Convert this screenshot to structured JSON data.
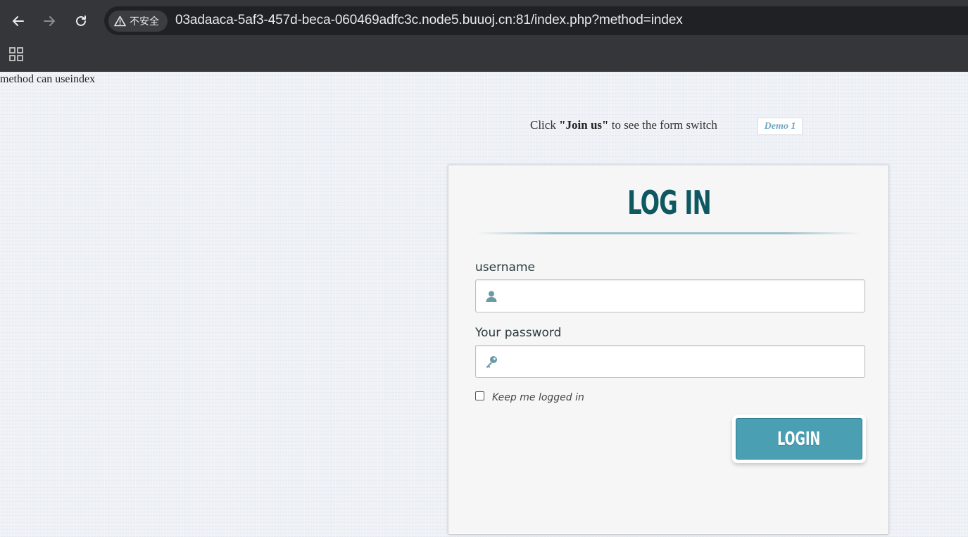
{
  "browser": {
    "security_label": "不安全",
    "url": "03adaaca-5af3-457d-beca-060469adfc3c.node5.buuoj.cn:81/index.php?method=index"
  },
  "page": {
    "method_note": "method can useindex",
    "hint_prefix": "Click ",
    "hint_bold": "\"Join us\"",
    "hint_suffix": " to see the form switch",
    "demo_tab": "Demo 1"
  },
  "login_form": {
    "title": "Log in",
    "username_label": "username",
    "username_value": "",
    "password_label": "Your password",
    "password_value": "",
    "keep_logged_in_label": "Keep me logged in",
    "keep_logged_in_checked": false,
    "submit_label": "Login"
  },
  "colors": {
    "accent": "#4a9fb3",
    "title": "#0e5862",
    "chrome": "#35363a"
  }
}
